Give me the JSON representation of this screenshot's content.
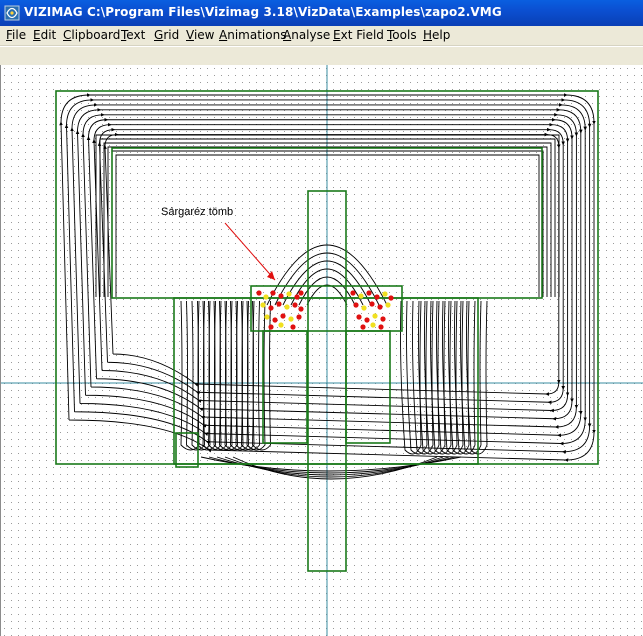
{
  "window": {
    "title": "VIZIMAG C:\\Program Files\\Vizimag 3.18\\VizData\\Examples\\zapo2.VMG",
    "app_icon": "vizimag-icon"
  },
  "menu": {
    "items": [
      {
        "label": "File"
      },
      {
        "label": "Edit"
      },
      {
        "label": "Clipboard"
      },
      {
        "label": "Text"
      },
      {
        "label": "Grid"
      },
      {
        "label": "View"
      },
      {
        "label": "Animations"
      },
      {
        "label": "Analyse"
      },
      {
        "label": "Ext Field"
      },
      {
        "label": "Tools"
      },
      {
        "label": "Help"
      }
    ]
  },
  "canvas": {
    "annotation": "Sárgaréz tömb",
    "colors": {
      "outline": "#1a7a1a",
      "field_line": "#000000",
      "axis": "#3a8ca0",
      "particle_red": "#e01010",
      "particle_yellow": "#f0e020"
    }
  }
}
